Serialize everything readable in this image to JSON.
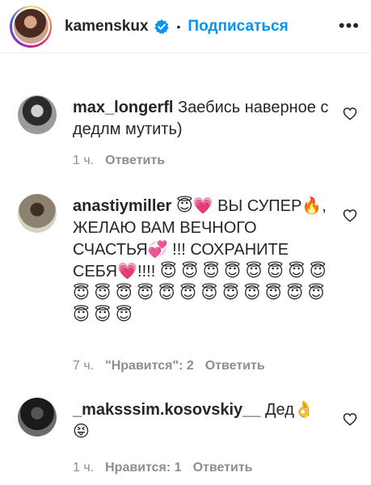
{
  "header": {
    "username": "kamenskux",
    "separator": "•",
    "follow_label": "Подписаться",
    "more_icon": "•••"
  },
  "comments": [
    {
      "username": "max_longerfl",
      "text": " Заебись наверное с дедлм мутить)",
      "time": "1 ч.",
      "likes": "",
      "reply": "Ответить"
    },
    {
      "username": "anastiymiller",
      "text_parts": [
        " ",
        "😇",
        "💗",
        " ВЫ СУПЕР",
        "🔥",
        ", ЖЕЛАЮ ВАМ ВЕЧНОГО СЧАСТЬЯ",
        "💞",
        " !!! СОХРАНИТЕ СЕБЯ",
        "💗",
        "!!!! "
      ],
      "angel_count": 23,
      "time": "7 ч.",
      "likes": "\"Нравится\": 2",
      "reply": "Ответить"
    },
    {
      "username": "_maksssim.kosovskiy__",
      "text": " Дед",
      "emoji_1": "👌",
      "emoji_2": "😝",
      "time": "1 ч.",
      "likes": "Нравится: 1",
      "reply": "Ответить"
    }
  ],
  "colors": {
    "accent": "#0095f6",
    "meta": "#8e8e8e",
    "text": "#262626"
  }
}
